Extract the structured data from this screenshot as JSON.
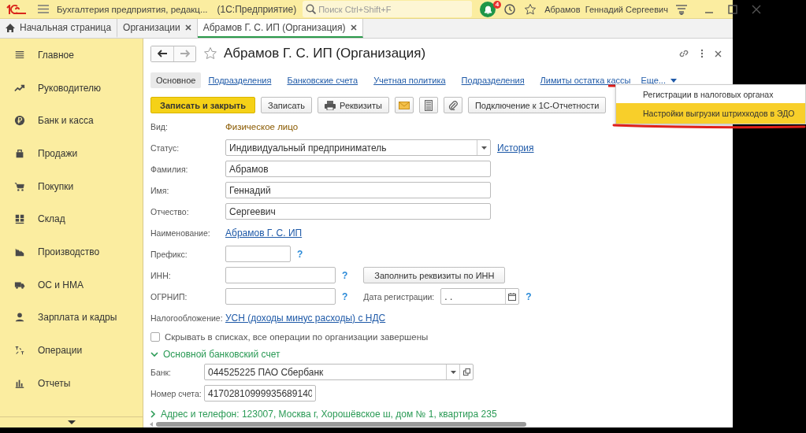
{
  "title_bar": {
    "app_title": "Бухгалтерия предприятия, редакц...",
    "platform": "(1С:Предприятие)",
    "search": {
      "placeholder": "Поиск Ctrl+Shift+F"
    },
    "notification_count": "4",
    "user": "Абрамов  Геннадий Сергеевич"
  },
  "open_tabs": [
    {
      "label": "Начальная страница",
      "selected": false,
      "closable": false
    },
    {
      "label": "Организации",
      "selected": false,
      "closable": true
    },
    {
      "label": "Абрамов Г. С. ИП (Организация)",
      "selected": true,
      "closable": true
    }
  ],
  "sidebar": {
    "items": [
      {
        "label": "Главное"
      },
      {
        "label": "Руководителю"
      },
      {
        "label": "Банк и касса"
      },
      {
        "label": "Продажи"
      },
      {
        "label": "Покупки"
      },
      {
        "label": "Склад"
      },
      {
        "label": "Производство"
      },
      {
        "label": "ОС и НМА"
      },
      {
        "label": "Зарплата и кадры"
      },
      {
        "label": "Операции"
      },
      {
        "label": "Отчеты"
      }
    ]
  },
  "form": {
    "title": "Абрамов Г. С. ИП (Организация)",
    "sections": [
      {
        "label": "Основное",
        "selected": true
      },
      {
        "label": "Подразделения",
        "selected": false
      },
      {
        "label": "Банковские счета",
        "selected": false
      },
      {
        "label": "Учетная политика",
        "selected": false
      },
      {
        "label": "Подразделения",
        "selected": false
      },
      {
        "label": "Лимиты остатка кассы",
        "selected": false
      }
    ],
    "more": "Еще...",
    "more_menu": [
      {
        "label": "Регистрации в налоговых органах",
        "selected": false
      },
      {
        "label": "Настройки выгрузки штрихкодов в ЭДО",
        "selected": true
      }
    ],
    "buttons": [
      {
        "label": "Записать и закрыть",
        "kind": "primary"
      },
      {
        "label": "Записать",
        "kind": "text"
      },
      {
        "label": "Реквизиты",
        "kind": "print"
      },
      {
        "kind": "mail"
      },
      {
        "kind": "calc"
      },
      {
        "kind": "clip"
      },
      {
        "label": "Подключение к 1С-Отчетности",
        "kind": "text"
      }
    ],
    "vid": {
      "label": "Вид:",
      "value": "Физическое лицо"
    },
    "status": {
      "label": "Статус:",
      "value": "Индивидуальный предприниматель",
      "link": "История"
    },
    "last_name": {
      "label": "Фамилия:",
      "value": "Абрамов"
    },
    "first_name": {
      "label": "Имя:",
      "value": "Геннадий"
    },
    "patronymic": {
      "label": "Отчество:",
      "value": "Сергеевич"
    },
    "name": {
      "label": "Наименование:",
      "link": "Абрамов Г. С. ИП"
    },
    "prefix": {
      "label": "Префикс:",
      "help": "?"
    },
    "inn": {
      "label": "ИНН:",
      "help": "?",
      "button": "Заполнить реквизиты по ИНН"
    },
    "ogrnip": {
      "label": "ОГРНИП:",
      "help": "?"
    },
    "reg_date": {
      "label": "Дата регистрации:",
      "value": " .  .",
      "help": "?"
    },
    "taxation": {
      "label": "Налогообложение:",
      "link": "УСН (доходы минус расходы) с НДС"
    },
    "hide_checkbox": {
      "label": "Скрывать в списках, все операции по организации завершены",
      "checked": false
    },
    "bank_group": {
      "title": "Основной банковский счет",
      "expanded": true
    },
    "bank": {
      "label": "Банк:",
      "value": "044525225 ПАО Сбербанк"
    },
    "account": {
      "label": "Номер счета:",
      "value": "41702810999935689140"
    },
    "address_group": {
      "title": "Адрес и телефон: 123007, Москва г, Хорошёвское ш, дом № 1, квартира 235",
      "expanded": false
    }
  }
}
